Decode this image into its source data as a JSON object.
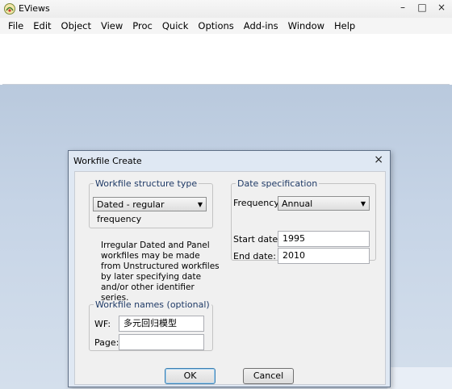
{
  "app": {
    "title": "EViews"
  },
  "window_controls": {
    "minimize": "–",
    "maximize": "□",
    "close": "×"
  },
  "menu": [
    "File",
    "Edit",
    "Object",
    "View",
    "Proc",
    "Quick",
    "Options",
    "Add-ins",
    "Window",
    "Help"
  ],
  "dialog": {
    "title": "Workfile Create",
    "close": "×",
    "structure": {
      "legend": "Workfile structure type",
      "selected": "Dated - regular frequency",
      "info": "Irregular Dated and Panel workfiles may be made from Unstructured workfiles by later specifying date and/or other identifier series."
    },
    "date_spec": {
      "legend": "Date specification",
      "frequency_label": "Frequency:",
      "frequency_value": "Annual",
      "start_label": "Start date:",
      "start_value": "1995",
      "end_label": "End date:",
      "end_value": "2010"
    },
    "names": {
      "legend": "Workfile names (optional)",
      "wf_label": "WF:",
      "wf_value": "多元回归模型",
      "page_label": "Page:",
      "page_value": ""
    },
    "ok_label": "OK",
    "cancel_label": "Cancel"
  }
}
